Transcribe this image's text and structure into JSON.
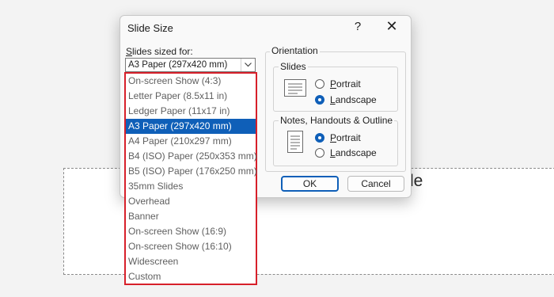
{
  "background": {
    "placeholder_fragment": "le"
  },
  "dialog": {
    "title": "Slide Size",
    "help_glyph": "?",
    "close_glyph": "✕",
    "sized_for_label_prefix": "S",
    "sized_for_label_rest": "lides sized for:",
    "selected_value": "A3 Paper (297x420 mm)",
    "orientation": {
      "legend": "Orientation",
      "slides": {
        "legend": "Slides",
        "portrait_prefix": "P",
        "portrait_rest": "ortrait",
        "landscape_prefix": "L",
        "landscape_rest": "andscape",
        "selected": "Landscape"
      },
      "notes": {
        "legend": "Notes, Handouts & Outline",
        "portrait_prefix": "P",
        "portrait_rest": "ortrait",
        "landscape_prefix": "L",
        "landscape_rest": "andscape",
        "selected": "Portrait"
      }
    },
    "ok_label": "OK",
    "cancel_label": "Cancel"
  },
  "dropdown": {
    "items": [
      "On-screen Show (4:3)",
      "Letter Paper (8.5x11 in)",
      "Ledger Paper (11x17 in)",
      "A3 Paper (297x420 mm)",
      "A4 Paper (210x297 mm)",
      "B4 (ISO) Paper (250x353 mm)",
      "B5 (ISO) Paper (176x250 mm)",
      "35mm Slides",
      "Overhead",
      "Banner",
      "On-screen Show (16:9)",
      "On-screen Show (16:10)",
      "Widescreen",
      "Custom"
    ],
    "selected_index": 3
  },
  "colors": {
    "accent": "#0f5fb8",
    "highlight_border": "#d7202a"
  }
}
